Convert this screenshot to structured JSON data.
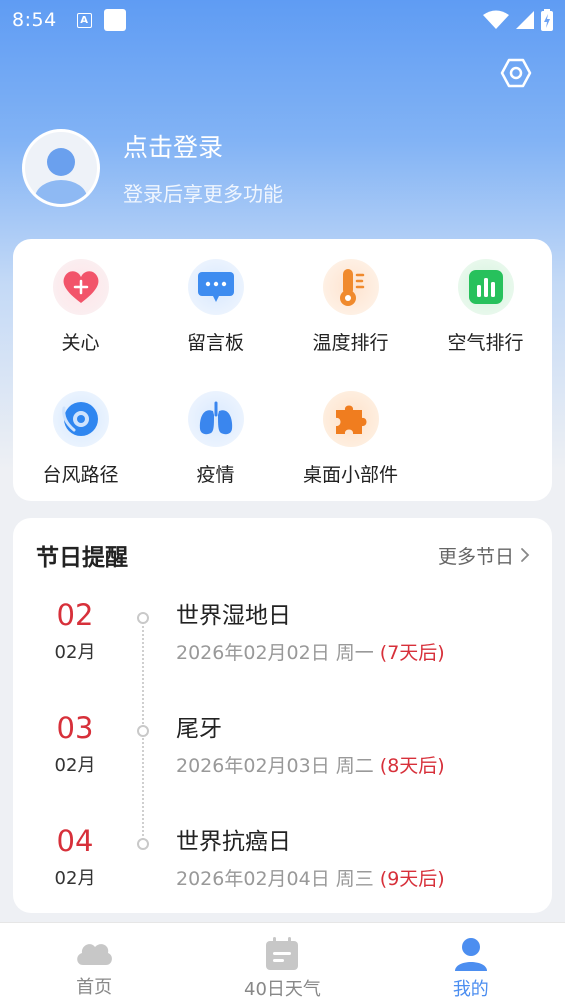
{
  "status_bar": {
    "time": "8:54",
    "a_icon": "A"
  },
  "profile": {
    "title": "点击登录",
    "subtitle": "登录后享更多功能"
  },
  "tools": [
    {
      "label": "关心",
      "icon": "heart-plus-icon"
    },
    {
      "label": "留言板",
      "icon": "message-board-icon"
    },
    {
      "label": "温度排行",
      "icon": "thermometer-icon"
    },
    {
      "label": "空气排行",
      "icon": "air-chart-icon"
    },
    {
      "label": "台风路径",
      "icon": "typhoon-icon"
    },
    {
      "label": "疫情",
      "icon": "lungs-icon"
    },
    {
      "label": "桌面小部件",
      "icon": "puzzle-icon"
    }
  ],
  "festivals": {
    "title": "节日提醒",
    "more_label": "更多节日",
    "items": [
      {
        "day": "02",
        "month": "02月",
        "name": "世界湿地日",
        "date": "2026年02月02日 周一 ",
        "countdown": "(7天后)"
      },
      {
        "day": "03",
        "month": "02月",
        "name": "尾牙",
        "date": "2026年02月03日 周二 ",
        "countdown": "(8天后)"
      },
      {
        "day": "04",
        "month": "02月",
        "name": "世界抗癌日",
        "date": "2026年02月04日 周三 ",
        "countdown": "(9天后)"
      }
    ]
  },
  "bottom_nav": {
    "items": [
      {
        "label": "首页",
        "icon": "cloud-icon"
      },
      {
        "label": "40日天气",
        "icon": "calendar-icon"
      },
      {
        "label": "我的",
        "icon": "person-icon",
        "active": true
      }
    ]
  },
  "colors": {
    "accent": "#4c8ef0",
    "festival_red": "#d7303a"
  }
}
